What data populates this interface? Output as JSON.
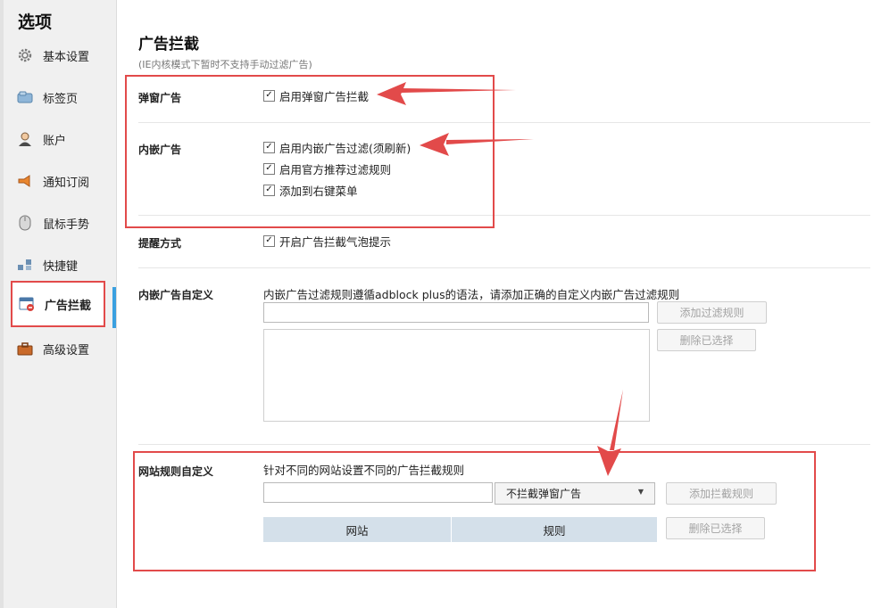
{
  "window": {
    "title": "选项"
  },
  "sidebar": {
    "items": [
      {
        "label": "基本设置",
        "icon": "gear-icon"
      },
      {
        "label": "标签页",
        "icon": "tab-icon"
      },
      {
        "label": "账户",
        "icon": "user-icon"
      },
      {
        "label": "通知订阅",
        "icon": "megaphone-icon"
      },
      {
        "label": "鼠标手势",
        "icon": "mouse-icon"
      },
      {
        "label": "快捷键",
        "icon": "keyboard-icon"
      },
      {
        "label": "广告拦截",
        "icon": "ad-block-icon",
        "active": true
      },
      {
        "label": "高级设置",
        "icon": "briefcase-icon"
      }
    ]
  },
  "main": {
    "title": "广告拦截",
    "subtitle": "(IE内核模式下暂时不支持手动过滤广告)",
    "popup_ads": {
      "label": "弹窗广告",
      "options": [
        {
          "label": "启用弹窗广告拦截",
          "checked": true
        }
      ]
    },
    "embedded_ads": {
      "label": "内嵌广告",
      "options": [
        {
          "label": "启用内嵌广告过滤(须刷新)",
          "checked": true
        },
        {
          "label": "启用官方推荐过滤规则",
          "checked": true
        },
        {
          "label": "添加到右键菜单",
          "checked": true
        }
      ]
    },
    "reminder": {
      "label": "提醒方式",
      "options": [
        {
          "label": "开启广告拦截气泡提示",
          "checked": true
        }
      ]
    },
    "embedded_custom": {
      "label": "内嵌广告自定义",
      "description": "内嵌广告过滤规则遵循adblock plus的语法，请添加正确的自定义内嵌广告过滤规则",
      "input_value": "",
      "add_button": "添加过滤规则",
      "delete_button": "删除已选择"
    },
    "site_rules": {
      "label": "网站规则自定义",
      "description": "针对不同的网站设置不同的广告拦截规则",
      "input_value": "",
      "select_value": "不拦截弹窗广告",
      "add_button": "添加拦截规则",
      "delete_button": "删除已选择",
      "columns": [
        "网站",
        "规则"
      ]
    }
  },
  "annotations": {
    "highlight_color": "#e24a4a",
    "tab_accent_color": "#3aa0e0"
  }
}
